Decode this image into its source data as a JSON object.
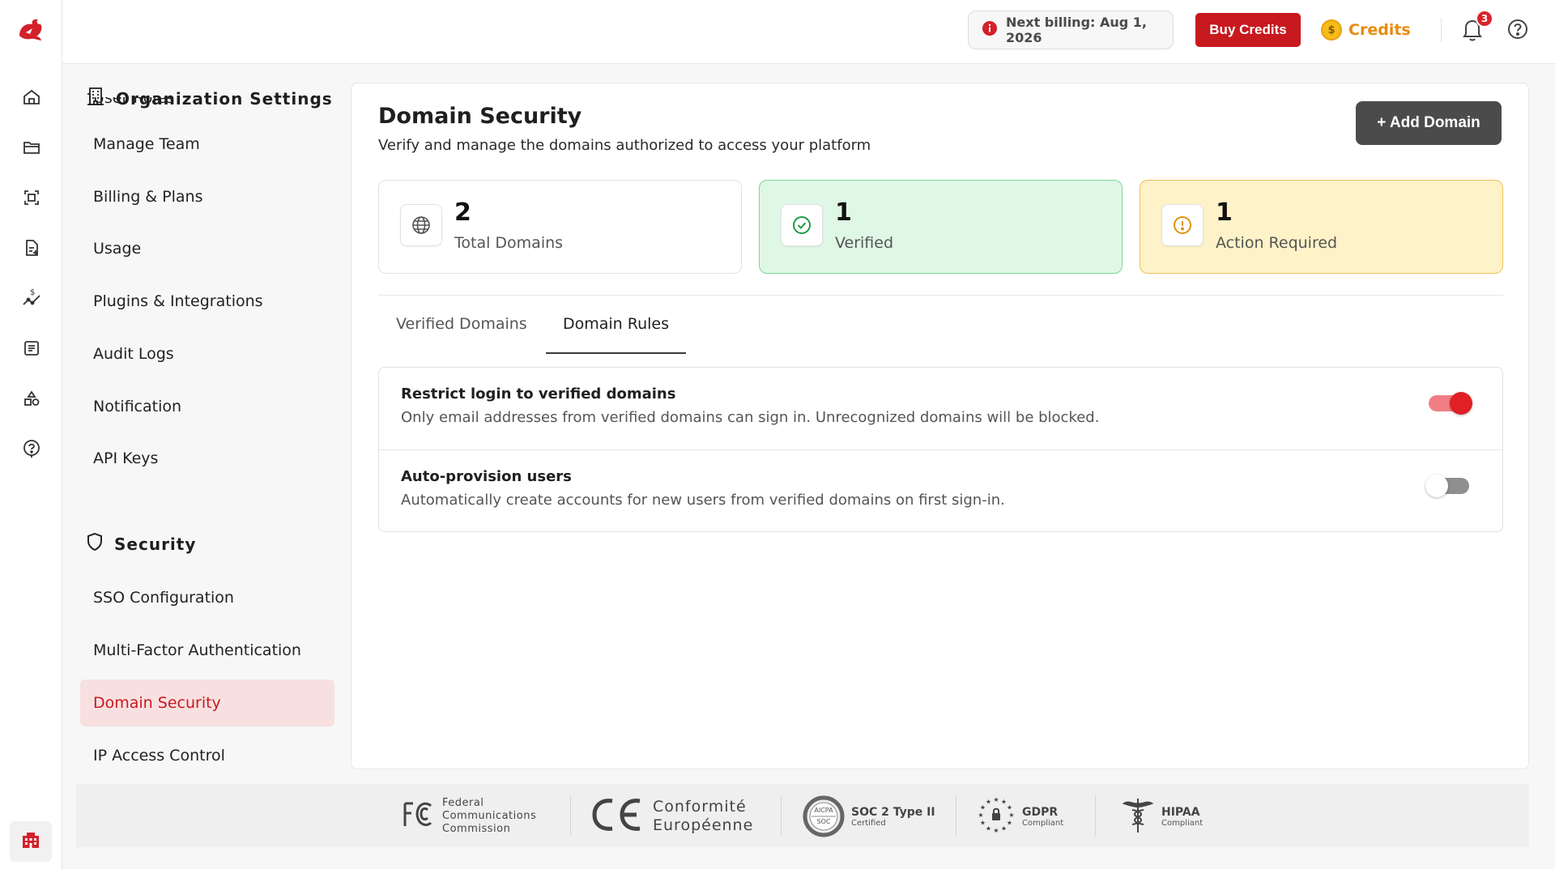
{
  "header": {
    "billing_text": "Next billing: Aug 1, 2026",
    "buy_credits_label": "Buy Credits",
    "credits_label": "Credits",
    "coin_symbol": "$",
    "notification_count": "3"
  },
  "rail": {
    "icons": [
      "home-icon",
      "folder-icon",
      "scan-icon",
      "document-add-icon",
      "cost-chart-icon",
      "list-icon",
      "shapes-icon",
      "help-icon"
    ],
    "bottom_icon": "building-icon"
  },
  "sidebar": {
    "title": "Organization Settings",
    "partial_item": "User Roles",
    "items": [
      "Manage Team",
      "Billing & Plans",
      "Usage",
      "Plugins & Integrations",
      "Audit Logs",
      "Notification",
      "API Keys"
    ],
    "security_title": "Security",
    "security_items": [
      "SSO Configuration",
      "Multi-Factor Authentication",
      "Domain Security",
      "IP Access Control"
    ],
    "active_item": "Domain Security"
  },
  "main": {
    "title": "Domain Security",
    "subtitle": "Verify and manage the domains authorized to access your platform",
    "add_button": "+ Add Domain",
    "stats": [
      {
        "value": "2",
        "label": "Total Domains",
        "icon": "globe-icon"
      },
      {
        "value": "1",
        "label": "Verified",
        "icon": "check-circle-icon"
      },
      {
        "value": "1",
        "label": "Action Required",
        "icon": "alert-circle-icon"
      }
    ],
    "tabs": [
      "Verified Domains",
      "Domain Rules"
    ],
    "active_tab": "Domain Rules",
    "rules": [
      {
        "title": "Restrict login to verified domains",
        "description": "Only email addresses from verified domains can sign in. Unrecognized domains will be blocked.",
        "enabled": true
      },
      {
        "title": "Auto-provision users",
        "description": "Automatically create accounts for new users from verified domains on first sign-in.",
        "enabled": false
      }
    ]
  },
  "compliance": {
    "fcc_lines": [
      "Federal",
      "Communications",
      "Commission"
    ],
    "ce_lines": [
      "Conformité",
      "Européenne"
    ],
    "soc_title": "SOC 2 Type II",
    "soc_sub": "Certified",
    "soc_seal_top": "AICPA",
    "soc_seal_bottom": "SOC",
    "gdpr_title": "GDPR",
    "gdpr_sub": "Compliant",
    "hipaa_title": "HIPAA",
    "hipaa_sub": "Compliant"
  },
  "colors": {
    "brand_red": "#c8191e",
    "credits_orange": "#e88b10",
    "verified_bg": "#dff7e5",
    "action_bg": "#fdf2c8",
    "active_nav_bg": "#f8e0e1"
  }
}
